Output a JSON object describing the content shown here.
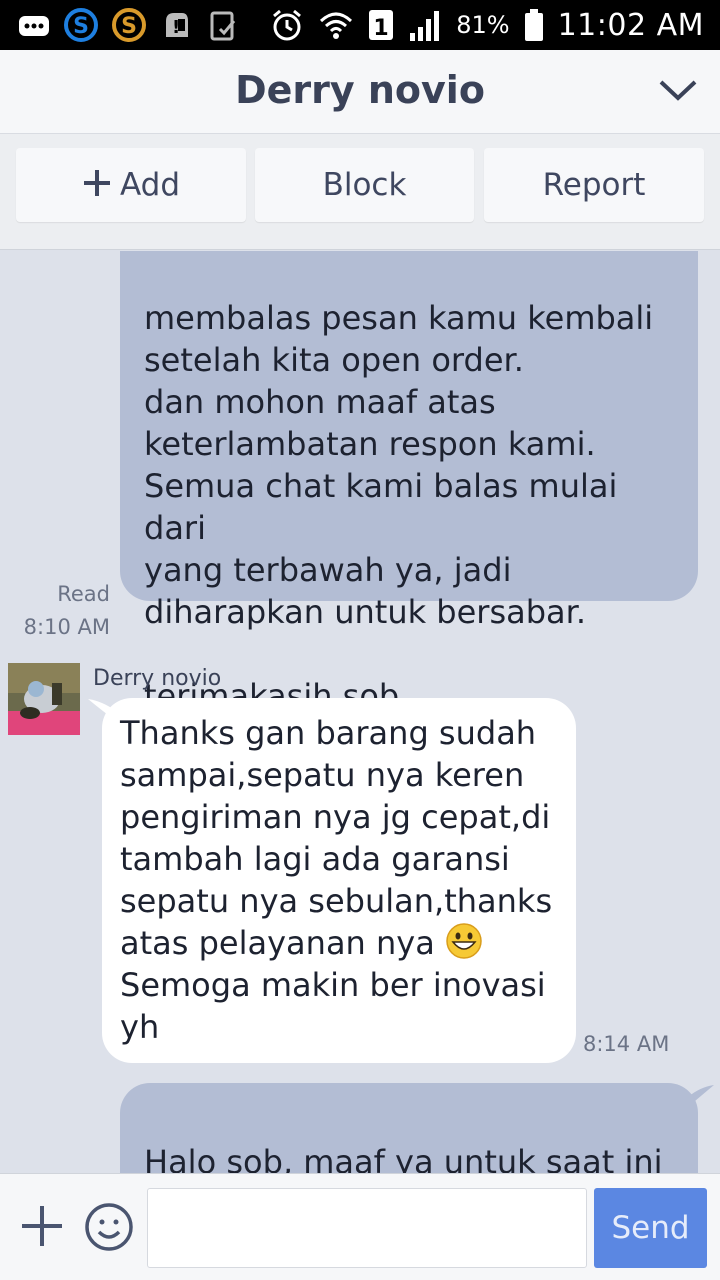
{
  "status_bar": {
    "battery_percent": "81%",
    "time": "11:02 AM",
    "sim_slot": "1",
    "icons": [
      "messages-icon",
      "skype-icon",
      "sync-icon",
      "notification-icon",
      "clipboard-icon",
      "alarm-icon",
      "wifi-icon",
      "sim-icon",
      "signal-icon",
      "battery-icon"
    ]
  },
  "header": {
    "title": "Derry novio"
  },
  "actions": {
    "add_label": "Add",
    "block_label": "Block",
    "report_label": "Report"
  },
  "messages": [
    {
      "direction": "outgoing",
      "text": "membalas pesan kamu kembali\nsetelah kita open order.\ndan mohon maaf atas\nketerlambatan respon kami.\nSemua chat kami balas mulai dari\nyang terbawah ya, jadi\ndiharapkan untuk bersabar.\n\nterimakasih sob.",
      "status": "Read",
      "time": "8:10 AM"
    },
    {
      "direction": "incoming",
      "sender": "Derry novio",
      "text_before_emoji": "Thanks gan barang sudah\nsampai,sepatu nya keren\npengiriman nya jg cepat,di\ntambah lagi ada garansi\nsepatu nya sebulan,thanks\natas pelayanan nya ",
      "text_after_emoji": "\nSemoga makin ber inovasi\nyh",
      "emoji": "grinning-face-emoji",
      "time": "8:14 AM"
    },
    {
      "direction": "outgoing",
      "text": "Halo sob, maaf ya untuk saat ini\nkita closed order, kita akan"
    }
  ],
  "input": {
    "value": "",
    "send_label": "Send"
  },
  "colors": {
    "outgoing_bubble": "#b3bdd4",
    "incoming_bubble": "#ffffff",
    "chat_background": "#dde1ea",
    "send_button": "#5b87e2"
  }
}
